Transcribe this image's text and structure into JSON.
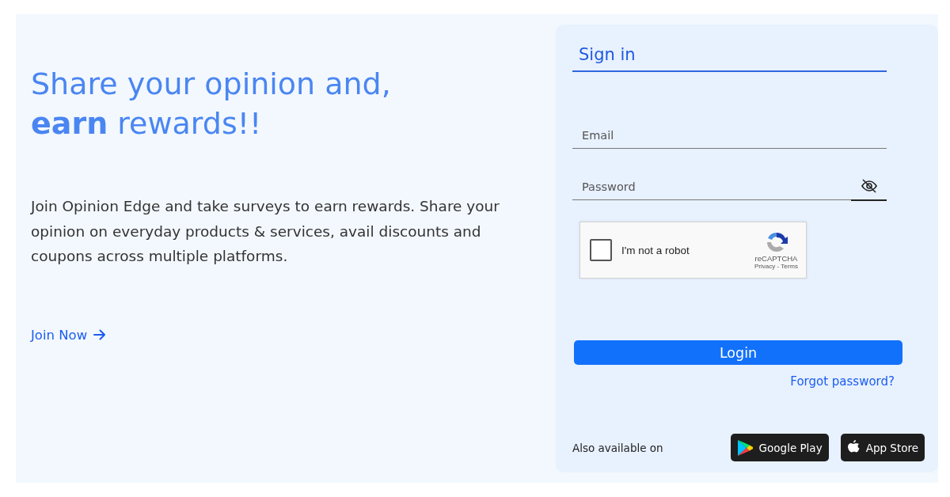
{
  "hero": {
    "headline_line1": "Share your opinion and,",
    "headline_line2": "**earn** rewards!!",
    "description": "Join Opinion Edge and take surveys to earn rewards. Share your opinion on everyday products & services, avail discounts and coupons across multiple platforms.",
    "join_link": "Join Now"
  },
  "sign_in": {
    "title": "Sign in",
    "email": {
      "placeholder": "Email"
    },
    "password": {
      "placeholder": "Password"
    },
    "captcha": {
      "label": "I'm not a robot",
      "checked": false,
      "brand": "reCAPTCHA",
      "links": "Privacy - Terms"
    },
    "login_button": "Login",
    "forgot_link": "Forgot password?",
    "also_available": "Also available on",
    "stores": [
      {
        "kind": "google",
        "label": "Google Play"
      },
      {
        "kind": "apple",
        "label": "App Store"
      }
    ]
  }
}
